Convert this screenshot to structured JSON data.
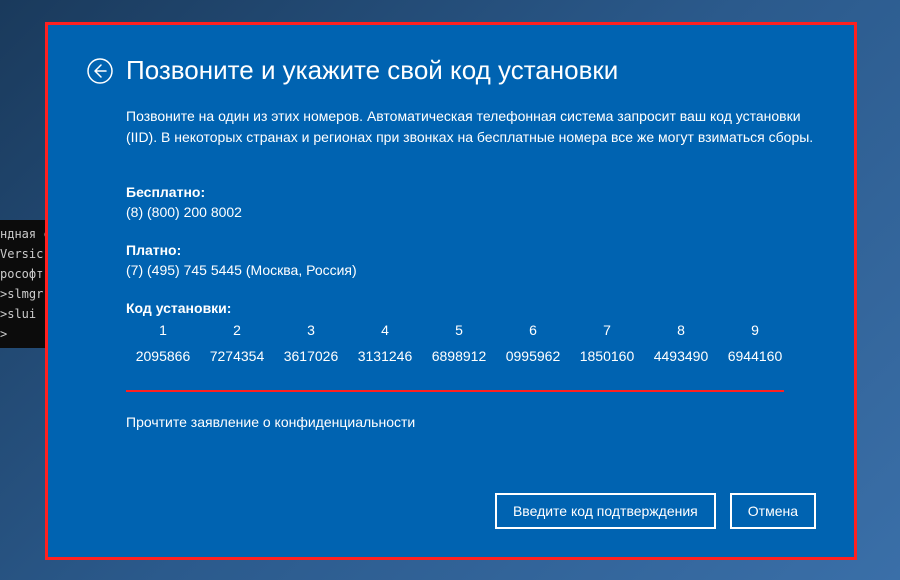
{
  "terminal": {
    "lines": [
      "ндная ст",
      "Versic",
      "рософт",
      "",
      ">slmgr",
      "",
      ">slui",
      "",
      ">"
    ]
  },
  "dialog": {
    "title": "Позвоните и укажите свой код установки",
    "instructions": "Позвоните на один из этих номеров. Автоматическая телефонная система запросит ваш код установки (IID). В некоторых странах и регионах при звонках на бесплатные номера все же могут взиматься сборы.",
    "free": {
      "label": "Бесплатно:",
      "value": "(8) (800) 200 8002"
    },
    "paid": {
      "label": "Платно:",
      "value": "(7) (495) 745 5445 (Москва, Россия)"
    },
    "iid": {
      "label": "Код установки:",
      "headers": [
        "1",
        "2",
        "3",
        "4",
        "5",
        "6",
        "7",
        "8",
        "9"
      ],
      "blocks": [
        "2095866",
        "7274354",
        "3617026",
        "3131246",
        "6898912",
        "0995962",
        "1850160",
        "4493490",
        "6944160"
      ]
    },
    "privacy": "Прочтите заявление о конфиденциальности",
    "buttons": {
      "confirm": "Введите код подтверждения",
      "cancel": "Отмена"
    }
  }
}
